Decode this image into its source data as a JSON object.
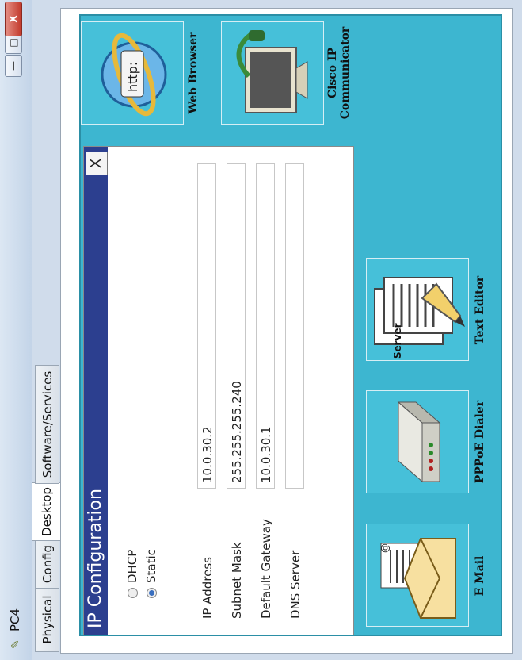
{
  "window": {
    "title": "PC4",
    "buttons": {
      "minimize": "—",
      "maximize": "□",
      "close": "X"
    }
  },
  "tabs": [
    {
      "label": "Physical"
    },
    {
      "label": "Config"
    },
    {
      "label": "Desktop"
    },
    {
      "label": "Software/Services"
    }
  ],
  "desktop_apps": {
    "email": "E Mail",
    "pppoe": "PPPoE Dialer",
    "text_editor": "Text Editor",
    "web_browser": "Web Browser",
    "cisco_ip_communicator": "Cisco IP Communicator",
    "obscured_label": "Server"
  },
  "web_browser_icon_text": "http:",
  "ip_config": {
    "title": "IP Configuration",
    "close_label": "X",
    "dhcp_label": "DHCP",
    "static_label": "Static",
    "selected_mode": "Static",
    "fields": {
      "ip_address_label": "IP Address",
      "ip_address_value": "10.0.30.2",
      "subnet_mask_label": "Subnet Mask",
      "subnet_mask_value": "255.255.255.240",
      "default_gateway_label": "Default Gateway",
      "default_gateway_value": "10.0.30.1",
      "dns_server_label": "DNS Server",
      "dns_server_value": ""
    }
  },
  "colors": {
    "desktop_bg": "#3db6d0",
    "dialog_header": "#2c3f8f",
    "radio_checked": "#3a6fbf"
  }
}
